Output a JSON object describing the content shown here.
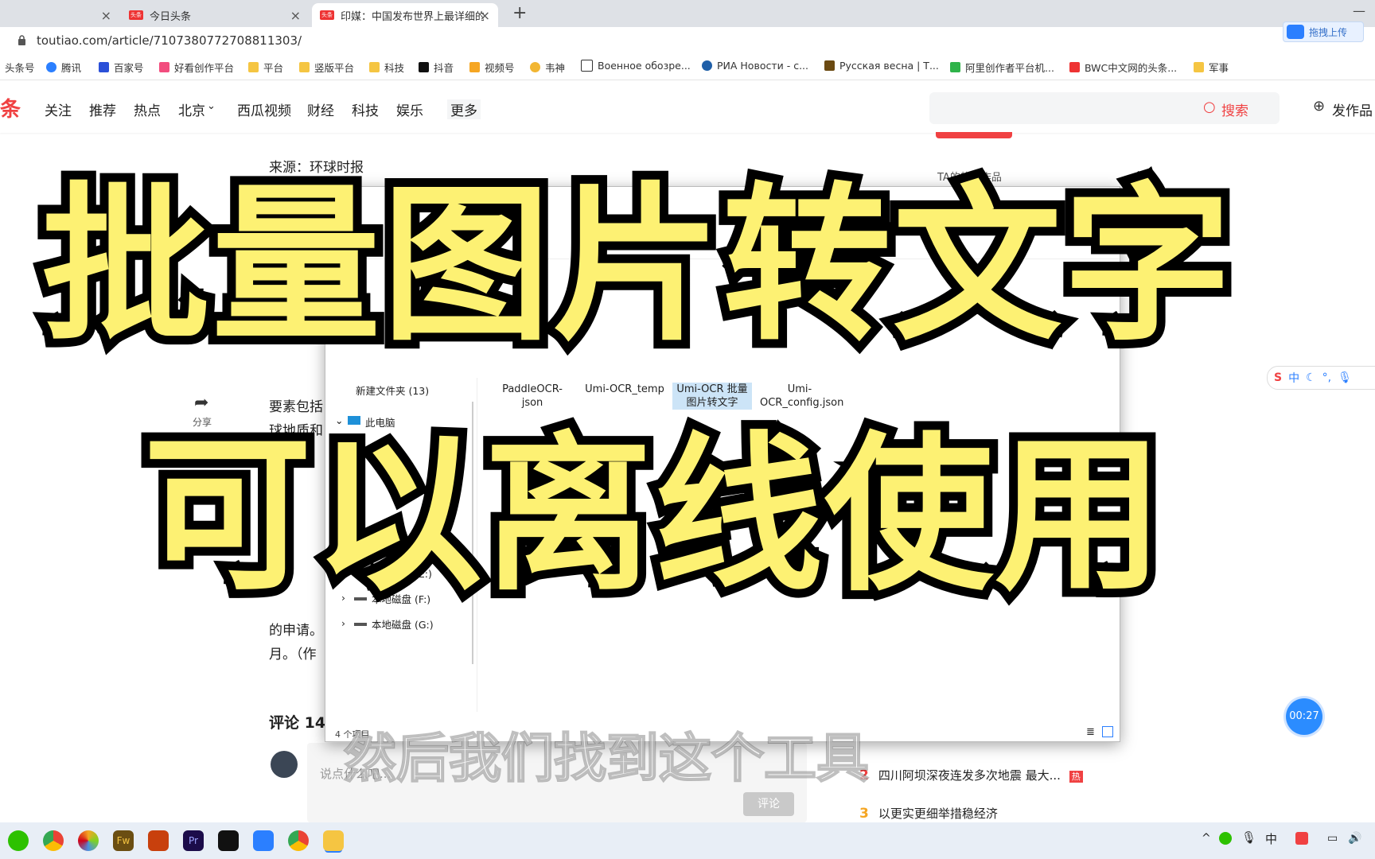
{
  "browser": {
    "tabs": [
      {
        "label": "今日头条"
      },
      {
        "label": "印媒：中国发布世界上最详细的月"
      }
    ],
    "new_tab": "+",
    "url": "toutiao.com/article/7107380772708811303/",
    "upload_badge": "拖拽上传",
    "bookmarks": [
      "头条号",
      "腾讯",
      "百家号",
      "好看创作平台",
      "平台",
      "竖版平台",
      "科技",
      "抖音",
      "视频号",
      "韦神",
      "Военное обозре...",
      "РИА Новости - с...",
      "Русская весна | Т...",
      "阿里创作者平台机...",
      "BWC中文网的头条...",
      "军事"
    ]
  },
  "site": {
    "logo_fragment": "条",
    "nav": [
      "关注",
      "推荐",
      "热点",
      "北京",
      "西瓜视频",
      "财经",
      "科技",
      "娱乐",
      "更多"
    ],
    "search_button": "搜索",
    "publish": "发作品"
  },
  "article": {
    "source": "来源：环球时报",
    "fragments": [
      "要素包括",
      "球地质和",
      "的申请。",
      "月。（作"
    ],
    "share": "分享",
    "comments_label": "评论 14",
    "comment_placeholder": "说点什么吧...",
    "comment_submit": "评论"
  },
  "sidebar": {
    "hot_works": "TA的热门作品",
    "trending": [
      {
        "rank": "2",
        "title": "四川阿坝深夜连发多次地震 最大..."
      },
      {
        "rank": "3",
        "title": "以更实更细举措稳经济"
      }
    ],
    "hot_badge": "热"
  },
  "explorer": {
    "tree": [
      "新建文件夹 (13)",
      "此电脑",
      "本地磁盘 (E:)",
      "本地磁盘 (F:)",
      "本地磁盘 (G:)"
    ],
    "files": [
      "PaddleOCR-json",
      "Umi-OCR_temp",
      "Umi-OCR 批量图片转文字",
      "Umi-OCR_config.json"
    ],
    "status": "4 个项目"
  },
  "overlay": {
    "line1": "批量图片转文字",
    "line2": "可以离线使用",
    "subtitle": "然后我们找到这个工具"
  },
  "timer": "00:27"
}
